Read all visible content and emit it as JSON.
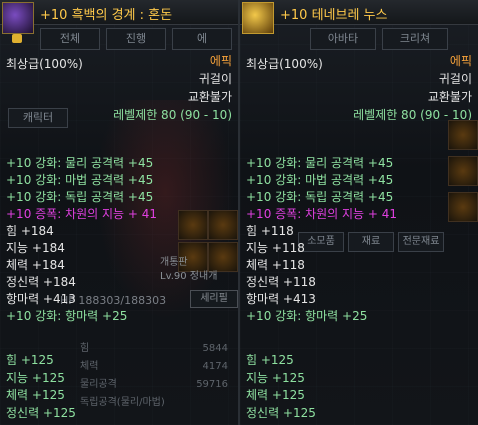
{
  "left": {
    "title": "+10 흑백의 경계 : 혼돈",
    "tabs": [
      "전체",
      "진행",
      "에"
    ],
    "grade": "최상급(100%)",
    "rarity": "에픽",
    "category": "귀걸이",
    "trade": "교환불가",
    "level_box": "캐릭터",
    "level": "레벨제한 80 (90 - 10)",
    "stats": [
      {
        "text": "+10 강화: 물리 공격력 +45",
        "color": "g"
      },
      {
        "text": "+10 강화: 마법 공격력 +45",
        "color": "g"
      },
      {
        "text": "+10 강화: 독립 공격력 +45",
        "color": "g"
      },
      {
        "text": "+10 증폭: 차원의 지능 + 41",
        "color": "m"
      },
      {
        "text": "힘 +184",
        "color": "w"
      },
      {
        "text": "지능 +184",
        "color": "w"
      },
      {
        "text": "체력 +184",
        "color": "w"
      },
      {
        "text": "정신력 +184",
        "color": "w"
      },
      {
        "text": "항마력 +413",
        "color": "w"
      },
      {
        "text": "+10 강화: 항마력 +25",
        "color": "g"
      }
    ],
    "bottom_stats": [
      {
        "text": "힘 +125"
      },
      {
        "text": "지능 +125"
      },
      {
        "text": "체력 +125"
      },
      {
        "text": "정신력 +125"
      }
    ],
    "bg": {
      "hp": "HP",
      "hp_val": "188303/188303",
      "rows": [
        "힘",
        "체력",
        "물리공격",
        "독립공격(물리/마법)"
      ],
      "vals": [
        "5844",
        "4174",
        "59716",
        ""
      ],
      "side_tag": "개통판\nLv.90 정내개",
      "side_btn": "세리필"
    }
  },
  "right": {
    "title": "+10 테네브레 누스",
    "tabs": [
      "아바타",
      "크리쳐"
    ],
    "grade": "최상급(100%)",
    "rarity": "에픽",
    "category": "귀걸이",
    "trade": "교환불가",
    "level": "레벨제한 80 (90 - 10)",
    "stats": [
      {
        "text": "+10 강화: 물리 공격력 +45",
        "color": "g"
      },
      {
        "text": "+10 강화: 마법 공격력 +45",
        "color": "g"
      },
      {
        "text": "+10 강화: 독립 공격력 +45",
        "color": "g"
      },
      {
        "text": "+10 증폭: 차원의 지능 + 41",
        "color": "m"
      },
      {
        "text": "힘 +118",
        "color": "w"
      },
      {
        "text": "지능 +118",
        "color": "w"
      },
      {
        "text": "체력 +118",
        "color": "w"
      },
      {
        "text": "정신력 +118",
        "color": "w"
      },
      {
        "text": "항마력 +413",
        "color": "w"
      },
      {
        "text": "+10 강화: 항마력 +25",
        "color": "g"
      }
    ],
    "bottom_stats": [
      {
        "text": "힘 +125"
      },
      {
        "text": "지능 +125"
      },
      {
        "text": "체력 +125"
      },
      {
        "text": "정신력 +125"
      }
    ],
    "bg_tabs": [
      "소모품",
      "재료",
      "전문재료"
    ]
  }
}
